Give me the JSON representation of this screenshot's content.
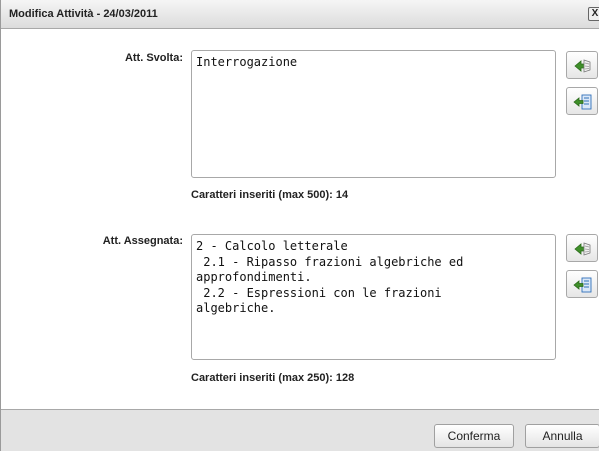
{
  "dialog": {
    "title": "Modifica Attività - 24/03/2011",
    "close_label": "X"
  },
  "att_svolta": {
    "label": "Att. Svolta:",
    "value": "Interrogazione",
    "counter": "Caratteri inseriti (max 500): 14",
    "buttons": [
      "copy-icon",
      "insert-icon"
    ]
  },
  "att_assegnata": {
    "label": "Att. Assegnata:",
    "value": "2 - Calcolo letterale\n 2.1 - Ripasso frazioni algebriche ed\napprofondimenti.\n 2.2 - Espressioni con le frazioni\nalgebriche.",
    "counter": "Caratteri inseriti (max 250): 128",
    "buttons": [
      "copy-icon",
      "insert-icon"
    ]
  },
  "footer": {
    "confirm_label": "Conferma",
    "cancel_label": "Annulla"
  },
  "colors": {
    "footer_bg": "#e3e3e3",
    "icon_green": "#3f8f2a",
    "icon_blue": "#2f6fb8"
  }
}
